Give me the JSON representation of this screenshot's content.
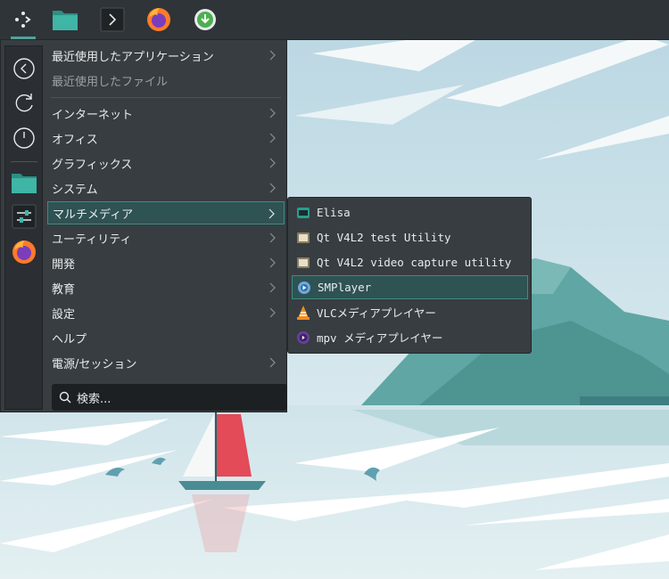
{
  "panel": {
    "launchers": [
      {
        "name": "application-launcher",
        "icon": "kickoff-icon"
      },
      {
        "name": "file-manager",
        "icon": "folder-icon"
      },
      {
        "name": "terminal",
        "icon": "terminal-icon"
      },
      {
        "name": "firefox",
        "icon": "firefox-icon"
      },
      {
        "name": "download",
        "icon": "download-icon"
      }
    ]
  },
  "menu": {
    "favorites": [
      "back-icon",
      "reload-icon",
      "power-icon",
      "folder-icon",
      "settings-icon",
      "firefox-icon"
    ],
    "recent_apps": "最近使用したアプリケーション",
    "recent_files": "最近使用したファイル",
    "categories": [
      {
        "label": "インターネット",
        "has_sub": true
      },
      {
        "label": "オフィス",
        "has_sub": true
      },
      {
        "label": "グラフィックス",
        "has_sub": true
      },
      {
        "label": "システム",
        "has_sub": true
      },
      {
        "label": "マルチメディア",
        "has_sub": true,
        "selected": true
      },
      {
        "label": "ユーティリティ",
        "has_sub": true
      },
      {
        "label": "開発",
        "has_sub": true
      },
      {
        "label": "教育",
        "has_sub": true
      },
      {
        "label": "設定",
        "has_sub": true
      },
      {
        "label": "ヘルプ",
        "has_sub": false
      },
      {
        "label": "電源/セッション",
        "has_sub": true
      }
    ],
    "search_placeholder": "検索..."
  },
  "submenu": {
    "items": [
      {
        "label": "Elisa",
        "icon": "elisa-icon"
      },
      {
        "label": "Qt V4L2 test Utility",
        "icon": "qv4l2-icon"
      },
      {
        "label": "Qt V4L2 video capture utility",
        "icon": "qvidcap-icon"
      },
      {
        "label": "SMPlayer",
        "icon": "smplayer-icon",
        "selected": true
      },
      {
        "label": "VLCメディアプレイヤー",
        "icon": "vlc-icon"
      },
      {
        "label": "mpv メディアプレイヤー",
        "icon": "mpv-icon"
      }
    ]
  },
  "colors": {
    "panel_bg": "#2f3438",
    "menu_bg": "#383d41",
    "highlight_bg": "#2f5253",
    "highlight_border": "#3f8b84",
    "text": "#e8ebed"
  }
}
